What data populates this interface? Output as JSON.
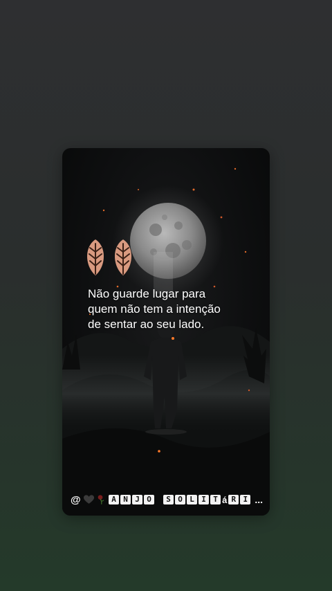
{
  "story": {
    "quote_line1": "Não guarde lugar para",
    "quote_line2": "quem não tem a intenção",
    "quote_line3": "de sentar ao seu lado.",
    "author": {
      "at": "@",
      "heart_icon": "black-heart-icon",
      "rose_icon": "wilted-rose-icon",
      "word1": [
        "A",
        "N",
        "J",
        "O"
      ],
      "word2": [
        "S",
        "O",
        "L",
        "I",
        "T"
      ],
      "word2_plain": "á",
      "word2_rest": [
        "R",
        "I"
      ],
      "ellipsis": "..."
    }
  },
  "colors": {
    "background_top": "#2e2f31",
    "background_bottom": "#243a2a",
    "leaf": "#d99a80",
    "leaf_vein": "#3a2016",
    "heart": "#3b3b3b",
    "rose": "#7a1d1d"
  }
}
